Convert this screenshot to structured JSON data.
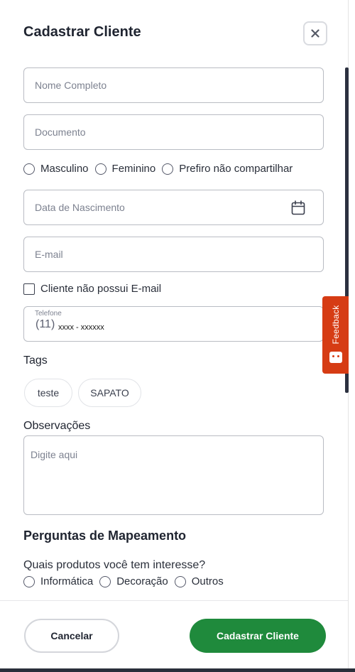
{
  "modal": {
    "title": "Cadastrar Cliente",
    "close_icon": "close-icon"
  },
  "form": {
    "name_placeholder": "Nome Completo",
    "document_placeholder": "Documento",
    "gender_options": [
      "Masculino",
      "Feminino",
      "Prefiro não compartilhar"
    ],
    "birthdate_placeholder": "Data de Nascimento",
    "calendar_icon": "calendar-icon",
    "email_placeholder": "E-mail",
    "no_email_label": "Cliente não possui E-mail",
    "phone": {
      "label": "Telefone",
      "area_code": "(11)",
      "value": "xxxx - xxxxxx"
    },
    "tags_label": "Tags",
    "tags": [
      "teste",
      "SAPATO"
    ],
    "notes_label": "Observações",
    "notes_placeholder": "Digite aqui"
  },
  "mapping": {
    "heading": "Perguntas de Mapeamento",
    "question": "Quais produtos você tem interesse?",
    "options": [
      "Informática",
      "Decoração",
      "Outros"
    ]
  },
  "footer": {
    "cancel_label": "Cancelar",
    "submit_label": "Cadastrar Cliente"
  },
  "feedback": {
    "label": "Feedback",
    "icon": "feedback-icon"
  },
  "colors": {
    "primary_green": "#1f8a3c",
    "feedback_orange": "#d63c14"
  }
}
